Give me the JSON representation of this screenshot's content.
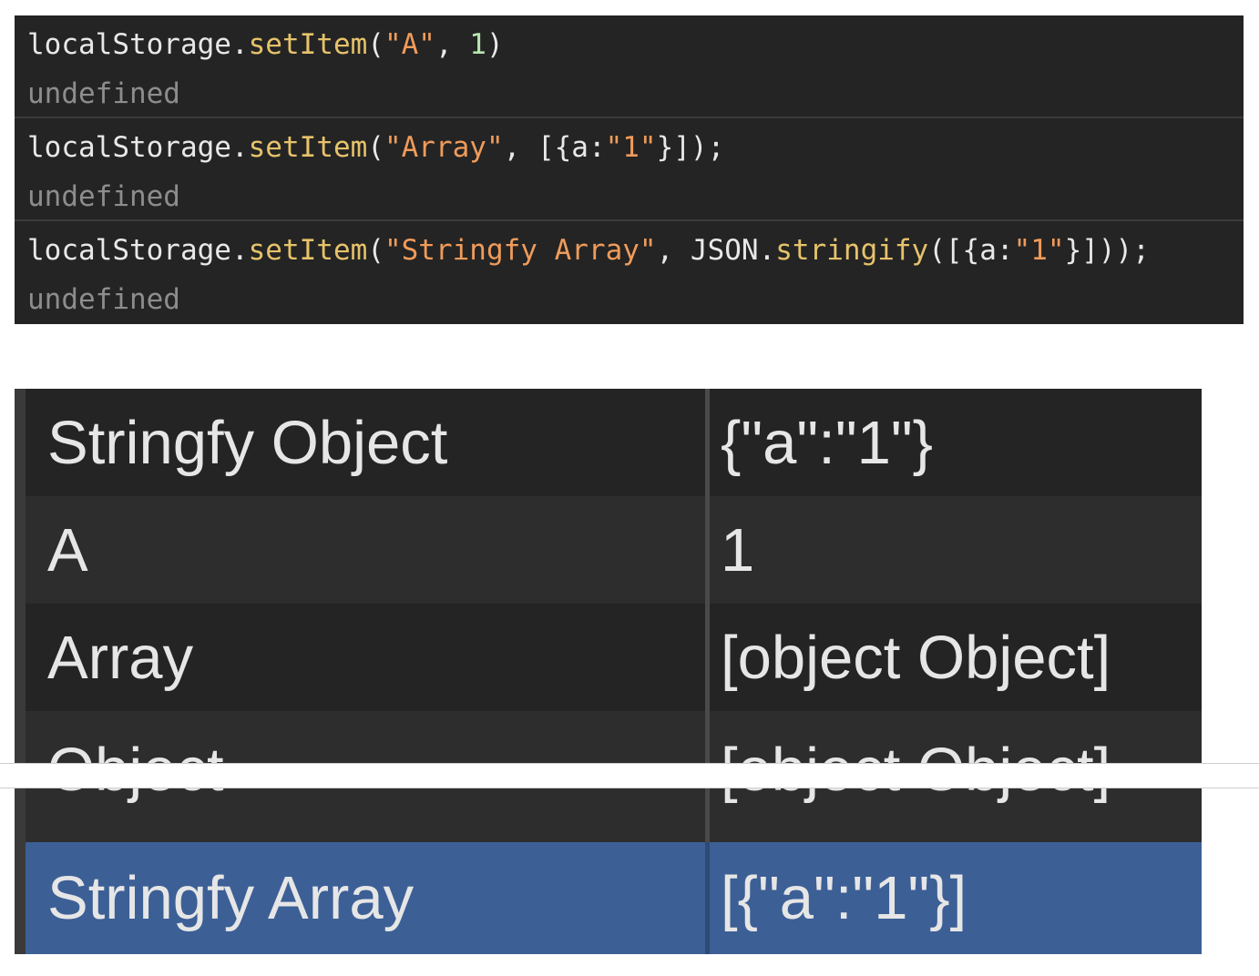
{
  "console": {
    "entries": [
      {
        "code": [
          {
            "t": "localStorage.",
            "k": "plain"
          },
          {
            "t": "setItem",
            "k": "method"
          },
          {
            "t": "(",
            "k": "plain"
          },
          {
            "t": "\"A\"",
            "k": "string"
          },
          {
            "t": ", ",
            "k": "plain"
          },
          {
            "t": "1",
            "k": "number"
          },
          {
            "t": ")",
            "k": "plain"
          }
        ],
        "result": "undefined"
      },
      {
        "code": [
          {
            "t": "localStorage.",
            "k": "plain"
          },
          {
            "t": "setItem",
            "k": "method"
          },
          {
            "t": "(",
            "k": "plain"
          },
          {
            "t": "\"Array\"",
            "k": "string"
          },
          {
            "t": ", [{a:",
            "k": "plain"
          },
          {
            "t": "\"1\"",
            "k": "string"
          },
          {
            "t": "}]);",
            "k": "plain"
          }
        ],
        "result": "undefined"
      },
      {
        "code": [
          {
            "t": "localStorage.",
            "k": "plain"
          },
          {
            "t": "setItem",
            "k": "method"
          },
          {
            "t": "(",
            "k": "plain"
          },
          {
            "t": "\"Stringfy Array\"",
            "k": "string"
          },
          {
            "t": ", JSON.",
            "k": "plain"
          },
          {
            "t": "stringify",
            "k": "method"
          },
          {
            "t": "([{a:",
            "k": "plain"
          },
          {
            "t": "\"1\"",
            "k": "string"
          },
          {
            "t": "}]));",
            "k": "plain"
          }
        ],
        "result": "undefined"
      }
    ]
  },
  "storage": {
    "rows": [
      {
        "key": "Stringfy Object",
        "value": "{\"a\":\"1\"}"
      },
      {
        "key": "A",
        "value": "1"
      },
      {
        "key": "Array",
        "value": "[object Object]"
      },
      {
        "key": "Object",
        "value": "[object Object]"
      },
      {
        "key": "Stringfy Array",
        "value": "[{\"a\":\"1\"}]",
        "selected": true
      }
    ]
  },
  "colors": {
    "console_bg": "#242424",
    "method": "#e6c26a",
    "string": "#f09b5a",
    "number": "#b8e6b0",
    "result": "#8d8d8d",
    "selected_row": "#3c5f96"
  }
}
